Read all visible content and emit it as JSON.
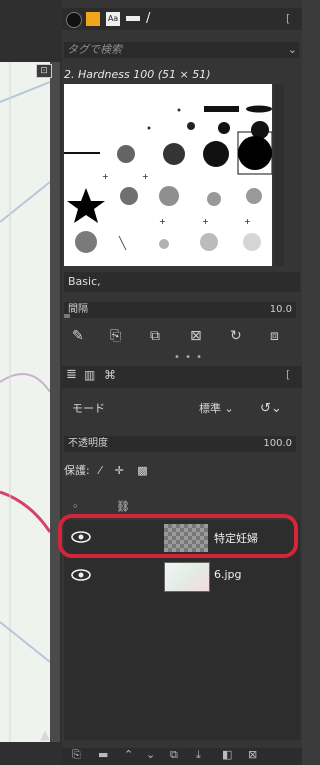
{
  "brushes": {
    "tag_placeholder": "タグで検索",
    "selected_brush": "2. Hardness 100 (51 × 51)",
    "brush_set": "Basic,",
    "spacing_label": "間隔",
    "spacing_value": "10.0"
  },
  "layers": {
    "mode_label": "モード",
    "mode_value": "標準",
    "opacity_label": "不透明度",
    "opacity_value": "100.0",
    "lock_label": "保護:",
    "items": [
      {
        "name": "特定妊婦",
        "visible": true,
        "highlighted": true
      },
      {
        "name": "6.jpg",
        "visible": true,
        "highlighted": false
      }
    ]
  },
  "colors": {
    "highlight": "#d5253a",
    "panel": "#353535"
  }
}
